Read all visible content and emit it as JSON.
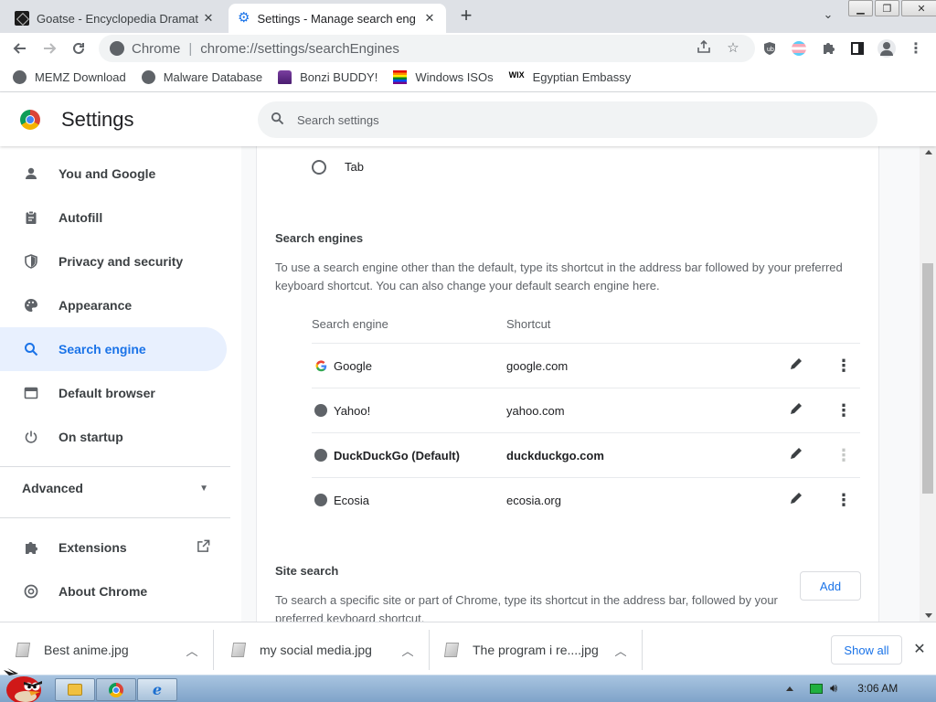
{
  "tabs": [
    {
      "title": "Goatse - Encyclopedia Dramat",
      "icon": "encyclopedia-dramatica-icon",
      "active": false
    },
    {
      "title": "Settings - Manage search eng",
      "icon": "settings-gear-icon",
      "active": true
    }
  ],
  "toolbar": {
    "site_label": "Chrome",
    "url_scheme": "chrome://",
    "url_rest": "settings/searchEngines"
  },
  "bookmarks": [
    {
      "label": "MEMZ Download",
      "icon": "globe-icon"
    },
    {
      "label": "Malware Database",
      "icon": "globe-icon"
    },
    {
      "label": "Bonzi BUDDY!",
      "icon": "bonzi-icon"
    },
    {
      "label": "Windows ISOs",
      "icon": "rainbow-flag-icon"
    },
    {
      "label": "Egyptian Embassy",
      "icon": "wix-icon"
    }
  ],
  "header": {
    "title": "Settings",
    "search_placeholder": "Search settings"
  },
  "sidebar": {
    "items": [
      {
        "label": "You and Google",
        "icon": "person-icon"
      },
      {
        "label": "Autofill",
        "icon": "clipboard-icon"
      },
      {
        "label": "Privacy and security",
        "icon": "shield-icon"
      },
      {
        "label": "Appearance",
        "icon": "palette-icon"
      },
      {
        "label": "Search engine",
        "icon": "search-icon",
        "active": true
      },
      {
        "label": "Default browser",
        "icon": "browser-window-icon"
      },
      {
        "label": "On startup",
        "icon": "power-icon"
      }
    ],
    "advanced_label": "Advanced",
    "extensions_label": "Extensions",
    "about_label": "About Chrome"
  },
  "main": {
    "radio_tab_label": "Tab",
    "search_engines_title": "Search engines",
    "search_engines_desc": "To use a search engine other than the default, type its shortcut in the address bar followed by your preferred keyboard shortcut. You can also change your default search engine here.",
    "col_engine": "Search engine",
    "col_shortcut": "Shortcut",
    "engines": [
      {
        "name": "Google",
        "shortcut": "google.com",
        "icon": "google-g-icon",
        "default": false
      },
      {
        "name": "Yahoo!",
        "shortcut": "yahoo.com",
        "icon": "globe-icon",
        "default": false
      },
      {
        "name": "DuckDuckGo (Default)",
        "shortcut": "duckduckgo.com",
        "icon": "globe-icon",
        "default": true
      },
      {
        "name": "Ecosia",
        "shortcut": "ecosia.org",
        "icon": "globe-icon",
        "default": false
      }
    ],
    "site_search_title": "Site search",
    "site_search_desc": "To search a specific site or part of Chrome, type its shortcut in the address bar, followed by your preferred keyboard shortcut.",
    "add_label": "Add"
  },
  "downloads": {
    "items": [
      {
        "name": "Best anime.jpg"
      },
      {
        "name": "my social media.jpg"
      },
      {
        "name": "The program i re....jpg"
      }
    ],
    "show_all_label": "Show all"
  },
  "taskbar": {
    "clock": "3:06 AM"
  },
  "colors": {
    "accent": "#1a73e8",
    "active_nav_bg": "#e8f0fe",
    "tabstrip_bg": "#dee1e6"
  }
}
